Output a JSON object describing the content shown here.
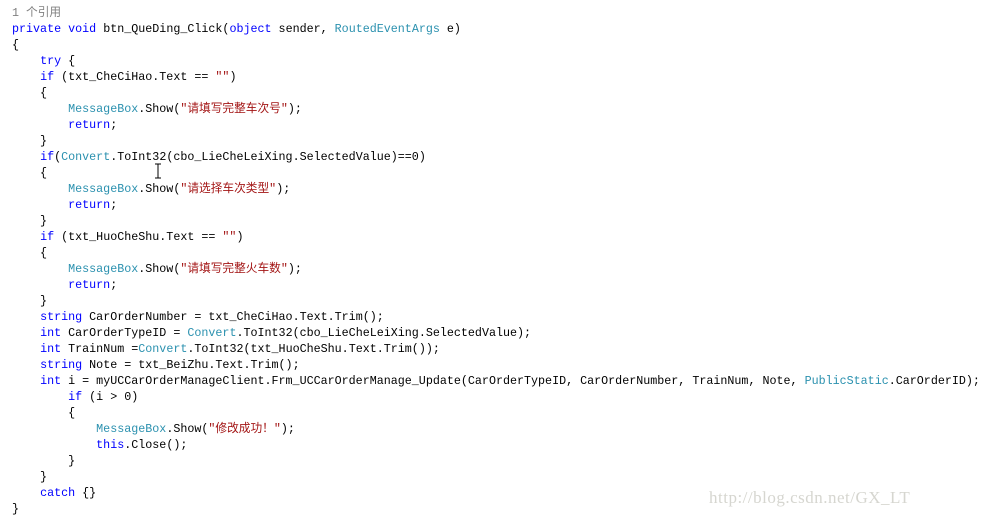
{
  "colors": {
    "keyword": "#0000ff",
    "type": "#2b91af",
    "string": "#a31515",
    "reference_hint": "#808080",
    "watermark": "#d6d6d0"
  },
  "code_lines": [
    [
      [
        "ref",
        "1 个引用"
      ]
    ],
    [
      [
        "kw",
        "private"
      ],
      [
        "plain",
        " "
      ],
      [
        "kw",
        "void"
      ],
      [
        "plain",
        " btn_QueDing_Click("
      ],
      [
        "kw",
        "object"
      ],
      [
        "plain",
        " sender, "
      ],
      [
        "type",
        "RoutedEventArgs"
      ],
      [
        "plain",
        " e)"
      ]
    ],
    [
      [
        "plain",
        "{"
      ]
    ],
    [
      [
        "plain",
        "    "
      ],
      [
        "kw",
        "try"
      ],
      [
        "plain",
        " {"
      ]
    ],
    [
      [
        "plain",
        "    "
      ],
      [
        "kw",
        "if"
      ],
      [
        "plain",
        " (txt_CheCiHao.Text == "
      ],
      [
        "str",
        "\"\""
      ],
      [
        "plain",
        ")"
      ]
    ],
    [
      [
        "plain",
        "    {"
      ]
    ],
    [
      [
        "plain",
        "        "
      ],
      [
        "type",
        "MessageBox"
      ],
      [
        "plain",
        ".Show("
      ],
      [
        "str",
        "\"请填写完整车次号\""
      ],
      [
        "plain",
        ");"
      ]
    ],
    [
      [
        "plain",
        "        "
      ],
      [
        "kw",
        "return"
      ],
      [
        "plain",
        ";"
      ]
    ],
    [
      [
        "plain",
        "    }"
      ]
    ],
    [
      [
        "plain",
        "    "
      ],
      [
        "kw",
        "if"
      ],
      [
        "plain",
        "("
      ],
      [
        "type",
        "Convert"
      ],
      [
        "plain",
        ".ToInt32(cbo_LieCheLeiXing.SelectedValue)==0)"
      ]
    ],
    [
      [
        "plain",
        "    {"
      ]
    ],
    [
      [
        "plain",
        "        "
      ],
      [
        "type",
        "MessageBox"
      ],
      [
        "plain",
        ".Show("
      ],
      [
        "str",
        "\"请选择车次类型\""
      ],
      [
        "plain",
        ");"
      ]
    ],
    [
      [
        "plain",
        "        "
      ],
      [
        "kw",
        "return"
      ],
      [
        "plain",
        ";"
      ]
    ],
    [
      [
        "plain",
        "    }"
      ]
    ],
    [
      [
        "plain",
        "    "
      ],
      [
        "kw",
        "if"
      ],
      [
        "plain",
        " (txt_HuoCheShu.Text == "
      ],
      [
        "str",
        "\"\""
      ],
      [
        "plain",
        ")"
      ]
    ],
    [
      [
        "plain",
        "    {"
      ]
    ],
    [
      [
        "plain",
        "        "
      ],
      [
        "type",
        "MessageBox"
      ],
      [
        "plain",
        ".Show("
      ],
      [
        "str",
        "\"请填写完整火车数\""
      ],
      [
        "plain",
        ");"
      ]
    ],
    [
      [
        "plain",
        "        "
      ],
      [
        "kw",
        "return"
      ],
      [
        "plain",
        ";"
      ]
    ],
    [
      [
        "plain",
        "    }"
      ]
    ],
    [
      [
        "plain",
        "    "
      ],
      [
        "kw",
        "string"
      ],
      [
        "plain",
        " CarOrderNumber = txt_CheCiHao.Text.Trim();"
      ]
    ],
    [
      [
        "plain",
        "    "
      ],
      [
        "kw",
        "int"
      ],
      [
        "plain",
        " CarOrderTypeID = "
      ],
      [
        "type",
        "Convert"
      ],
      [
        "plain",
        ".ToInt32(cbo_LieCheLeiXing.SelectedValue);"
      ]
    ],
    [
      [
        "plain",
        "    "
      ],
      [
        "kw",
        "int"
      ],
      [
        "plain",
        " TrainNum ="
      ],
      [
        "type",
        "Convert"
      ],
      [
        "plain",
        ".ToInt32(txt_HuoCheShu.Text.Trim());"
      ]
    ],
    [
      [
        "plain",
        "    "
      ],
      [
        "kw",
        "string"
      ],
      [
        "plain",
        " Note = txt_BeiZhu.Text.Trim();"
      ]
    ],
    [
      [
        "plain",
        "    "
      ],
      [
        "kw",
        "int"
      ],
      [
        "plain",
        " i = myUCCarOrderManageClient.Frm_UCCarOrderManage_Update(CarOrderTypeID, CarOrderNumber, TrainNum, Note, "
      ],
      [
        "type",
        "PublicStatic"
      ],
      [
        "plain",
        ".CarOrderID);"
      ]
    ],
    [
      [
        "plain",
        "        "
      ],
      [
        "kw",
        "if"
      ],
      [
        "plain",
        " (i > 0)"
      ]
    ],
    [
      [
        "plain",
        "        {"
      ]
    ],
    [
      [
        "plain",
        "            "
      ],
      [
        "type",
        "MessageBox"
      ],
      [
        "plain",
        ".Show("
      ],
      [
        "str",
        "\"修改成功！\""
      ],
      [
        "plain",
        ");"
      ]
    ],
    [
      [
        "plain",
        "            "
      ],
      [
        "kw",
        "this"
      ],
      [
        "plain",
        ".Close();"
      ]
    ],
    [
      [
        "plain",
        "        }"
      ]
    ],
    [
      [
        "plain",
        "    }"
      ]
    ],
    [
      [
        "plain",
        "    "
      ],
      [
        "kw",
        "catch"
      ],
      [
        "plain",
        " {}"
      ]
    ],
    [
      [
        "plain",
        "}"
      ]
    ]
  ],
  "cursor_icon": "text-ibeam-cursor",
  "watermark": "http://blog.csdn.net/GX_LT"
}
